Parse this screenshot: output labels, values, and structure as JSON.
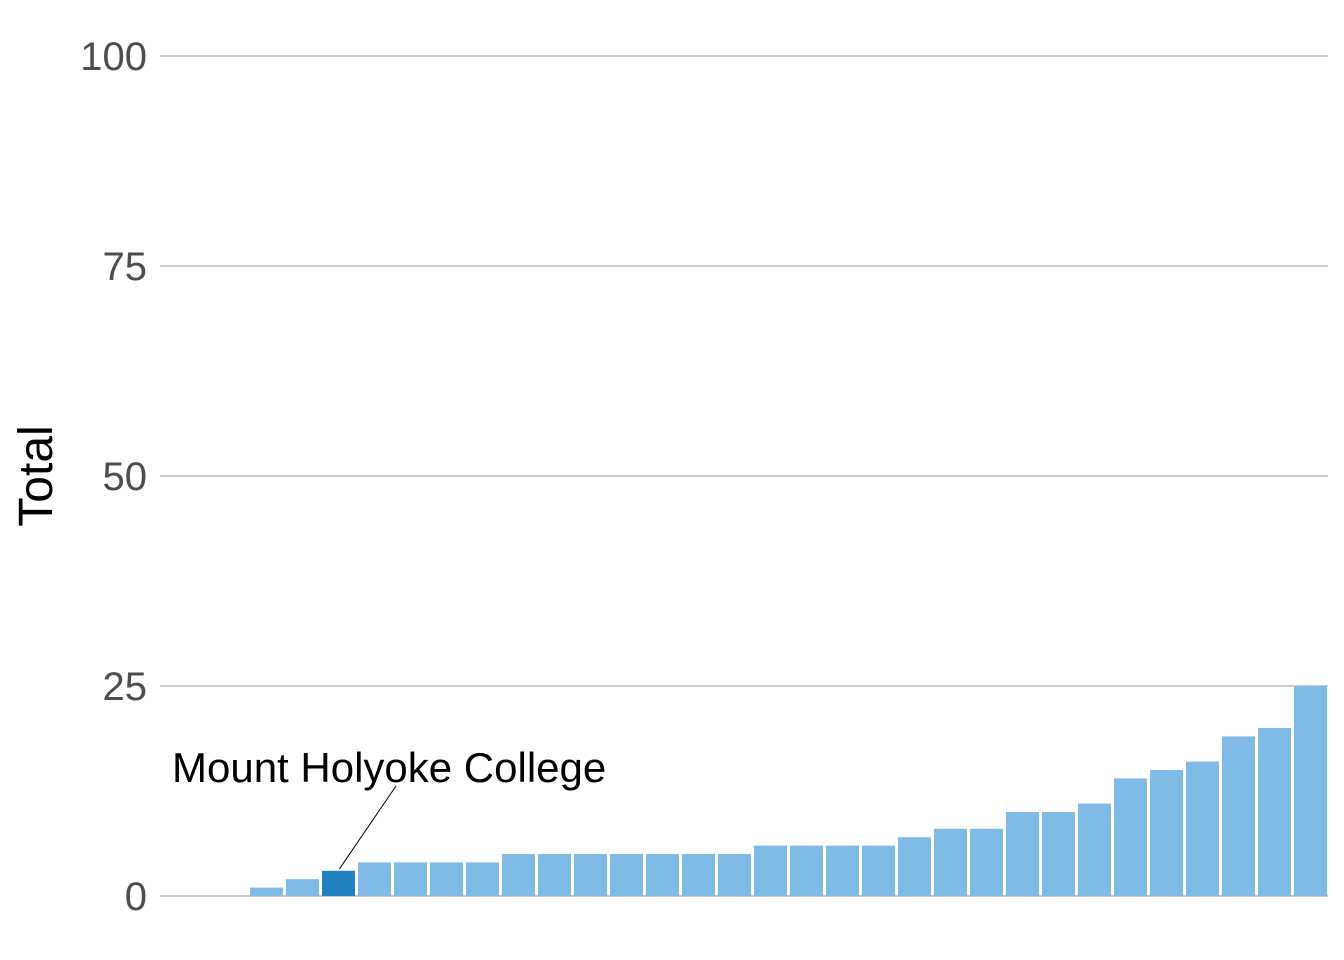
{
  "chart_data": {
    "type": "bar",
    "ylabel": "Total",
    "xlabel": "",
    "ylim": [
      0,
      100
    ],
    "yticks": [
      0,
      25,
      50,
      75,
      100
    ],
    "grid": true,
    "values": [
      0,
      0,
      1,
      2,
      3,
      4,
      4,
      4,
      4,
      5,
      5,
      5,
      5,
      5,
      5,
      5,
      6,
      6,
      6,
      6,
      7,
      8,
      8,
      10,
      10,
      11,
      14,
      15,
      16,
      19,
      20,
      25
    ],
    "highlight_index": 4,
    "annotation": {
      "text": "Mount Holyoke College",
      "bar_index": 4
    },
    "colors": {
      "bar": "#7fbbe6",
      "highlight": "#2080c0",
      "grid": "#bbbbbb",
      "tick_label": "#4d4d4d",
      "annotation_line": "#000000"
    }
  }
}
